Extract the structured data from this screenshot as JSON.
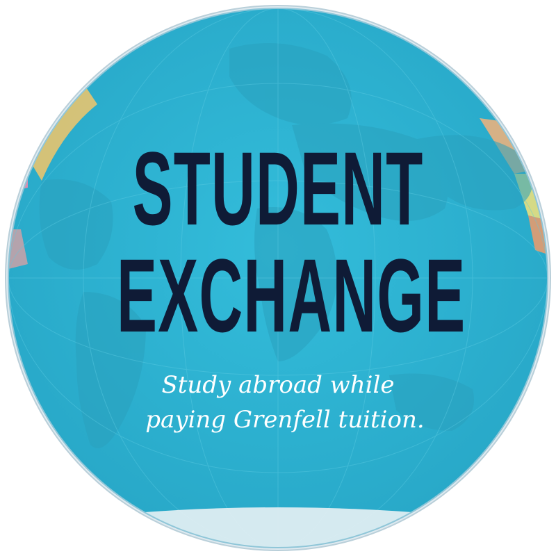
{
  "headline": {
    "line1": "STUDENT",
    "line2": "EXCHANGE"
  },
  "tagline": {
    "line1": "Study abroad while",
    "line2": "paying Grenfell tuition."
  },
  "colors": {
    "ocean": "#2fb8d6",
    "ocean_deep": "#29a9c8",
    "headline": "#0f1b36",
    "tagline": "#ffffff",
    "rim": "#c9dbe3"
  }
}
